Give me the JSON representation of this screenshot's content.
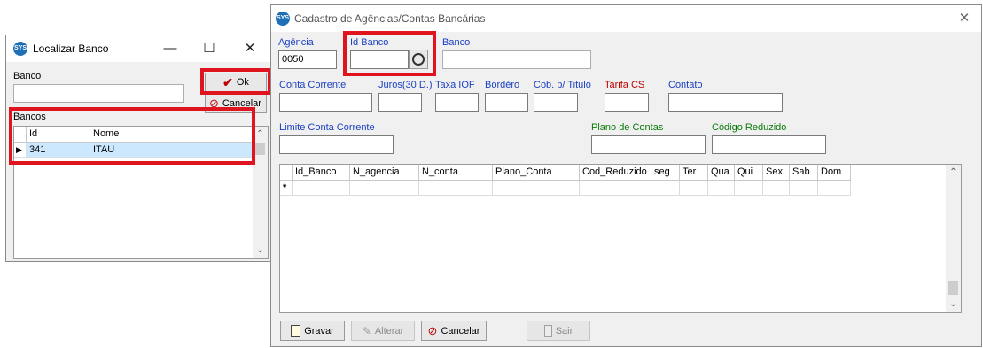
{
  "localizar": {
    "title": "Localizar Banco",
    "banco_label": "Banco",
    "banco_value": "",
    "ok_label": "Ok",
    "cancelar_label": "Cancelar",
    "bancos_label": "Bancos",
    "columns": [
      "Id",
      "Nome"
    ],
    "rows": [
      {
        "id": "341",
        "nome": "ITAU"
      }
    ]
  },
  "cadastro": {
    "title": "Cadastro de Agências/Contas Bancárias",
    "fields": {
      "agencia_label": "Agência",
      "agencia_value": "0050",
      "id_banco_label": "Id Banco",
      "id_banco_value": "",
      "banco_label": "Banco",
      "conta_corrente_label": "Conta Corrente",
      "juros_label": "Juros(30 D.)",
      "taxa_iof_label": "Taxa IOF",
      "bordero_label": "Borděro",
      "cob_titulo_label": "Cob. p/ Titulo",
      "tarifa_cs_label": "Tarifa CS",
      "contato_label": "Contato",
      "limite_label": "Limite Conta Corrente",
      "plano_label": "Plano de Contas",
      "codigo_reduzido_label": "Código Reduzido"
    },
    "grid": {
      "columns": [
        "Id_Banco",
        "N_agencia",
        "N_conta",
        "Plano_Conta",
        "Cod_Reduzido",
        "seg",
        "Ter",
        "Qua",
        "Qui",
        "Sex",
        "Sab",
        "Dom"
      ],
      "new_row_marker": "*"
    },
    "buttons": {
      "gravar": "Gravar",
      "alterar": "Alterar",
      "cancelar": "Cancelar",
      "sair": "Sair"
    }
  },
  "colors": {
    "highlight": "#e0141e",
    "label_blue": "#1a3fc2",
    "label_red": "#c00000",
    "label_green": "#0a7a0a",
    "selected_row": "#cce8ff"
  }
}
